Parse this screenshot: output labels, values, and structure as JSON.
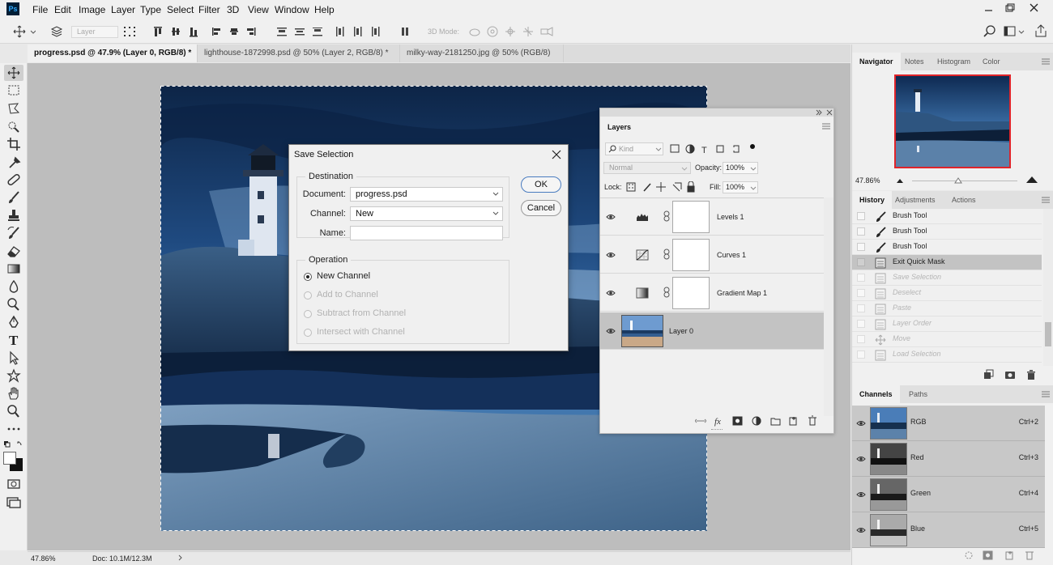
{
  "app": {
    "logo": "Ps"
  },
  "menu": [
    "File",
    "Edit",
    "Image",
    "Layer",
    "Type",
    "Select",
    "Filter",
    "3D",
    "View",
    "Window",
    "Help"
  ],
  "options": {
    "layer_dropdown": "Layer",
    "mode_3d": "3D Mode:"
  },
  "tabs": [
    {
      "label": "progress.psd @ 47.9% (Layer 0, RGB/8) *"
    },
    {
      "label": "lighthouse-1872998.psd @ 50% (Layer 2, RGB/8) *"
    },
    {
      "label": "milky-way-2181250.jpg @ 50% (RGB/8)"
    }
  ],
  "status": {
    "zoom": "47.86%",
    "doc": "Doc: 10.1M/12.3M"
  },
  "dialog": {
    "title": "Save Selection",
    "destination_legend": "Destination",
    "document_label": "Document:",
    "document_value": "progress.psd",
    "channel_label": "Channel:",
    "channel_value": "New",
    "name_label": "Name:",
    "name_value": "",
    "operation_legend": "Operation",
    "operations": [
      "New Channel",
      "Add to Channel",
      "Subtract from Channel",
      "Intersect with Channel"
    ],
    "ok": "OK",
    "cancel": "Cancel"
  },
  "layers_panel": {
    "tab": "Layers",
    "kind": "Kind",
    "blend": "Normal",
    "opacity_label": "Opacity:",
    "opacity": "100%",
    "lock_label": "Lock:",
    "fill_label": "Fill:",
    "fill": "100%",
    "layers": [
      {
        "name": "Levels 1"
      },
      {
        "name": "Curves 1"
      },
      {
        "name": "Gradient Map 1"
      },
      {
        "name": "Layer 0"
      }
    ]
  },
  "navigator": {
    "tabs": [
      "Navigator",
      "Notes",
      "Histogram",
      "Color"
    ],
    "zoom": "47.86%"
  },
  "history": {
    "tabs": [
      "History",
      "Adjustments",
      "Actions"
    ],
    "items": [
      {
        "name": "Brush Tool",
        "state": "normal"
      },
      {
        "name": "Brush Tool",
        "state": "normal"
      },
      {
        "name": "Brush Tool",
        "state": "normal"
      },
      {
        "name": "Exit Quick Mask",
        "state": "current"
      },
      {
        "name": "Save Selection",
        "state": "disabled"
      },
      {
        "name": "Deselect",
        "state": "disabled"
      },
      {
        "name": "Paste",
        "state": "disabled"
      },
      {
        "name": "Layer Order",
        "state": "disabled"
      },
      {
        "name": "Move",
        "state": "disabled"
      },
      {
        "name": "Load Selection",
        "state": "disabled"
      }
    ]
  },
  "channels": {
    "tabs": [
      "Channels",
      "Paths"
    ],
    "items": [
      {
        "name": "RGB",
        "shortcut": "Ctrl+2"
      },
      {
        "name": "Red",
        "shortcut": "Ctrl+3"
      },
      {
        "name": "Green",
        "shortcut": "Ctrl+4"
      },
      {
        "name": "Blue",
        "shortcut": "Ctrl+5"
      }
    ]
  },
  "colors": {
    "accent": "#1c5b9c",
    "ps_logo_bg": "#001e36",
    "ps_logo_fg": "#31a8ff"
  }
}
